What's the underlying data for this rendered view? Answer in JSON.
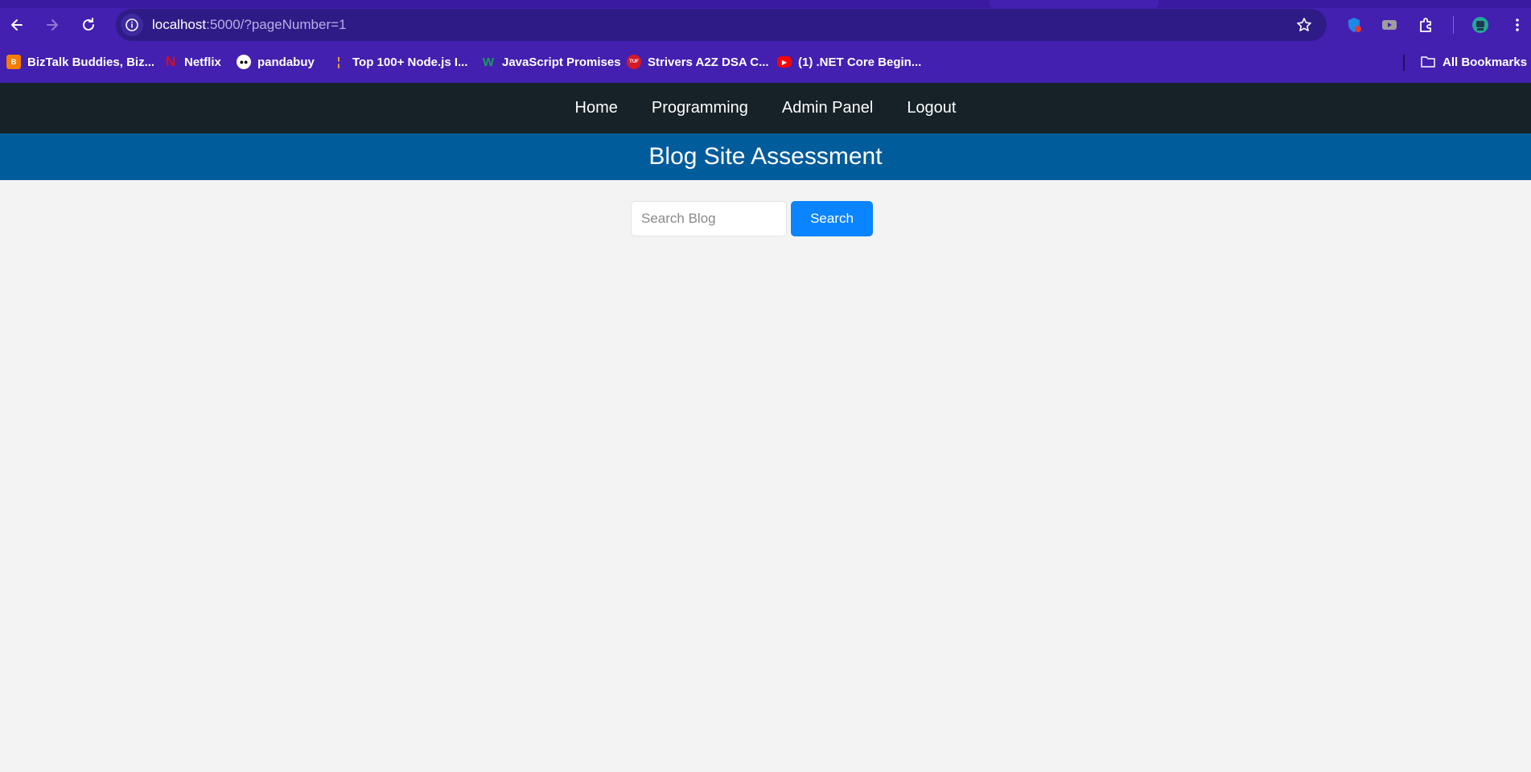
{
  "browser": {
    "url_host": "localhost",
    "url_rest": ":5000/?pageNumber=1",
    "bookmarks": [
      {
        "label": "BizTalk Buddies, Biz...",
        "icon": "blogger-icon",
        "color": "#f57d00"
      },
      {
        "label": "Netflix",
        "icon": "netflix-icon",
        "color": "#e50914"
      },
      {
        "label": "pandabuy",
        "icon": "panda-icon",
        "color": "#ffffff"
      },
      {
        "label": "Top 100+ Node.js I...",
        "icon": "bookmark-bar-icon",
        "color": "#f0a030"
      },
      {
        "label": "JavaScript Promises",
        "icon": "w-logo-icon",
        "color": "#1a9e5a"
      },
      {
        "label": "Strivers A2Z DSA C...",
        "icon": "tuf-icon",
        "color": "#d6182a"
      },
      {
        "label": "(1) .NET Core Begin...",
        "icon": "youtube-icon",
        "color": "#ff0000"
      }
    ],
    "all_bookmarks_label": "All Bookmarks"
  },
  "site": {
    "nav": [
      "Home",
      "Programming",
      "Admin Panel",
      "Logout"
    ],
    "header_title": "Blog Site Assessment",
    "search": {
      "placeholder": "Search Blog",
      "value": "",
      "button_label": "Search"
    },
    "colors": {
      "nav_bg": "#162128",
      "header_bg": "#015c9c",
      "button_bg": "#0a84ff"
    }
  }
}
